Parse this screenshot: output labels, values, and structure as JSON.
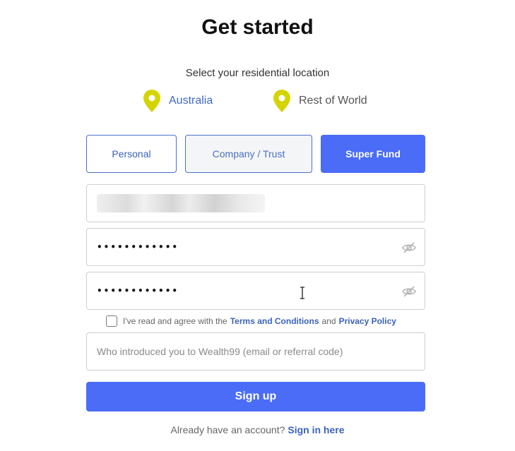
{
  "header": {
    "title": "Get started",
    "subtitle": "Select your residential location"
  },
  "locations": [
    {
      "label": "Australia",
      "icon": "location-pin-icon",
      "selected": true
    },
    {
      "label": "Rest of World",
      "icon": "location-pin-icon",
      "selected": false
    }
  ],
  "account_types": [
    {
      "label": "Personal",
      "selected": false
    },
    {
      "label": "Company / Trust",
      "selected": false
    },
    {
      "label": "Super Fund",
      "selected": true
    }
  ],
  "form": {
    "email_value": "",
    "password_value": "••••••••••••",
    "confirm_password_value": "••••••••••••",
    "terms": {
      "prefix": "I've read and agree with the",
      "terms_link": "Terms and Conditions",
      "middle": "and",
      "privacy_link": "Privacy Policy",
      "checked": false
    },
    "referral_placeholder": "Who introduced you to Wealth99 (email or referral code)",
    "submit_label": "Sign up"
  },
  "footer": {
    "prompt": "Already have an account?",
    "link": "Sign in here"
  },
  "colors": {
    "accent": "#4a6cf7",
    "link": "#3a62c0",
    "pin": "#d4d400"
  }
}
